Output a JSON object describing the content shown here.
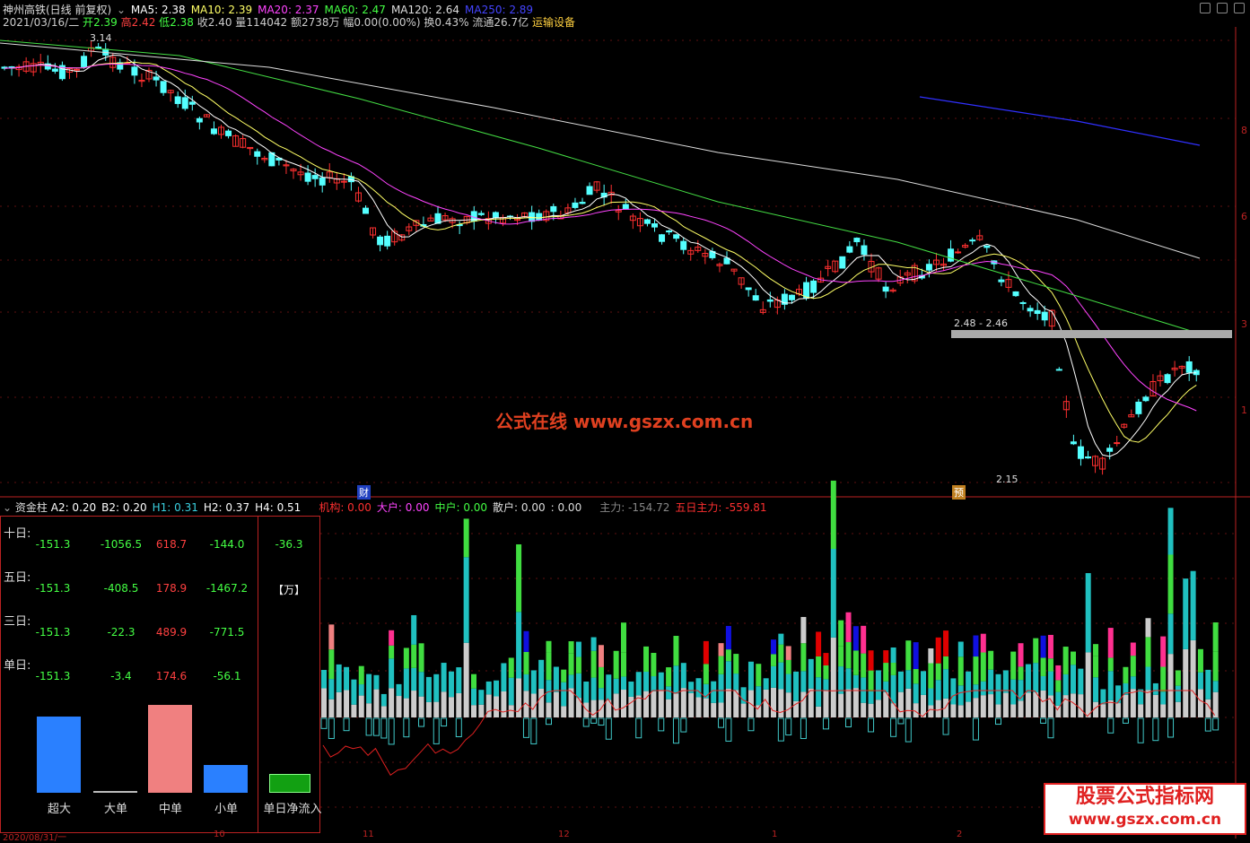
{
  "header": {
    "title": "神州高铁(日线 前复权)",
    "ma": [
      {
        "label": "MA5: 2.38",
        "color": "#ffffff"
      },
      {
        "label": "MA10: 2.39",
        "color": "#ffff66"
      },
      {
        "label": "MA20: 2.37",
        "color": "#ff44ff"
      },
      {
        "label": "MA60: 2.47",
        "color": "#44ff44"
      },
      {
        "label": "MA120: 2.64",
        "color": "#dddddd"
      },
      {
        "label": "MA250: 2.89",
        "color": "#4444ff"
      }
    ]
  },
  "quote": {
    "date": "2021/03/16/二",
    "open_label": "开",
    "open": "2.39",
    "high_label": "高",
    "high": "2.42",
    "low_label": "低",
    "low": "2.38",
    "close_label": "收",
    "close": "2.40",
    "vol_label": "量",
    "vol": "114042",
    "amt_label": "额",
    "amt": "2738万",
    "chg_label": "幅",
    "chg": "0.00(0.00%)",
    "turn_label": "换",
    "turn": "0.43%",
    "float_label": "流通",
    "float": "26.7亿",
    "industry": "运输设备"
  },
  "annotations": {
    "high_price": "3.14",
    "low_price": "2.15",
    "box_range": "2.48 - 2.46",
    "cai_tag": "财",
    "yu_tag": "预",
    "watermark": "公式在线  www.gszx.com.cn"
  },
  "right_axis": [
    "8",
    "6",
    "3",
    "1"
  ],
  "indicator": {
    "name": "资金柱",
    "values": [
      {
        "label": "A2: 0.20",
        "color": "#ffffff"
      },
      {
        "label": "B2: 0.20",
        "color": "#ffffff"
      },
      {
        "label": "H1: 0.31",
        "color": "#3ad0e0"
      },
      {
        "label": "H2: 0.37",
        "color": "#ffffff"
      },
      {
        "label": "H4: 0.51",
        "color": "#ffffff"
      },
      {
        "label": "机构: 0.00",
        "color": "#ff3030"
      },
      {
        "label": "大户: 0.00",
        "color": "#ff44ff"
      },
      {
        "label": "中户: 0.00",
        "color": "#44ff44"
      },
      {
        "label": "散户: 0.00",
        "color": "#dddddd"
      },
      {
        "label": ": 0.00",
        "color": "#dddddd"
      },
      {
        "label": "主力: -154.72",
        "color": "#888888"
      },
      {
        "label": "五日主力: -559.81",
        "color": "#ff3030"
      }
    ]
  },
  "panel": {
    "rows": [
      {
        "label": "十日:",
        "vals": [
          "-151.3",
          "-1056.5",
          "618.7",
          "-144.0"
        ],
        "net": "-36.3"
      },
      {
        "label": "五日:",
        "vals": [
          "-151.3",
          "-408.5",
          "178.9",
          "-1467.2"
        ],
        "net": "【万】"
      },
      {
        "label": "三日:",
        "vals": [
          "-151.3",
          "-22.3",
          "489.9",
          "-771.5"
        ],
        "net": ""
      },
      {
        "label": "单日:",
        "vals": [
          "-151.3",
          "-3.4",
          "174.6",
          "-56.1"
        ],
        "net": ""
      }
    ],
    "bars": [
      {
        "label": "超大",
        "value": -151.3,
        "color": "#2a80ff"
      },
      {
        "label": "大单",
        "value": -3.4,
        "color": "#bbbbbb"
      },
      {
        "label": "中单",
        "value": 174.6,
        "color": "#f08080"
      },
      {
        "label": "小单",
        "value": -56.1,
        "color": "#2a80ff"
      }
    ],
    "net_label": "单日净流入",
    "net_color": "#12a012"
  },
  "x_axis": [
    "2020/08/31/一",
    "10",
    "11",
    "12",
    "1",
    "2"
  ],
  "footer_logo": {
    "line1": "股票公式指标网",
    "line2": "www.gszx.com.cn"
  }
}
